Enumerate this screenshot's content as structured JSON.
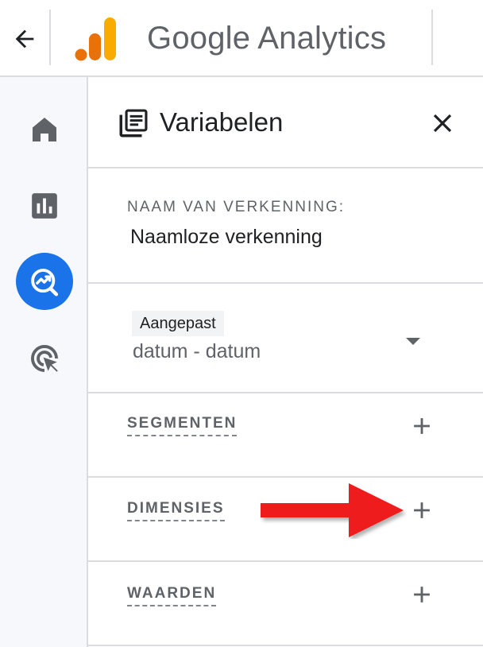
{
  "header": {
    "app_title": "Google Analytics",
    "back_icon": "arrow-back-icon",
    "logo_icon": "analytics-logo-icon"
  },
  "rail": {
    "items": [
      {
        "icon": "home-icon",
        "active": false
      },
      {
        "icon": "reports-icon",
        "active": false
      },
      {
        "icon": "explore-icon",
        "active": true
      },
      {
        "icon": "advertising-icon",
        "active": false
      }
    ]
  },
  "panel": {
    "title": "Variabelen",
    "title_icon": "variables-icon",
    "close_icon": "close-icon",
    "exploration_label": "NAAM VAN VERKENNING:",
    "exploration_name": "Naamloze verkenning",
    "date_badge": "Aangepast",
    "date_range": "datum - datum",
    "segments_label": "SEGMENTEN",
    "dimensions_label": "DIMENSIES",
    "metrics_label": "WAARDEN"
  },
  "colors": {
    "accent": "#1a73e8",
    "arrow_annotation": "#ee1c1c",
    "logo_orange": "#e8710a",
    "logo_yellow": "#f9ab00"
  }
}
